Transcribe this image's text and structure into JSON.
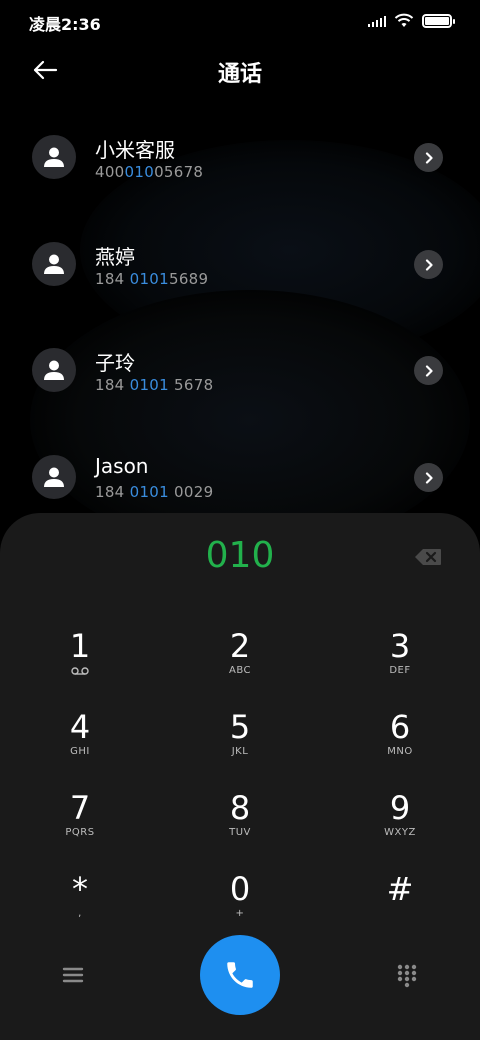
{
  "status": {
    "time": "凌晨2:36"
  },
  "header": {
    "title": "通话"
  },
  "contacts": [
    {
      "name": "小米客服",
      "num_pre": "400",
      "num_hl": "010",
      "num_post": "05678"
    },
    {
      "name": "燕婷",
      "num_pre": "184 ",
      "num_hl": "0101",
      "num_post": "5689"
    },
    {
      "name": "子玲",
      "num_pre": "184 ",
      "num_hl": "0101",
      "num_post": " 5678"
    },
    {
      "name": "Jason",
      "num_pre": "184 ",
      "num_hl": "0101",
      "num_post": " 0029"
    }
  ],
  "dialpad": {
    "entered": "010",
    "keys": [
      {
        "num": "1",
        "sub": ""
      },
      {
        "num": "2",
        "sub": "ABC"
      },
      {
        "num": "3",
        "sub": "DEF"
      },
      {
        "num": "4",
        "sub": "GHI"
      },
      {
        "num": "5",
        "sub": "JKL"
      },
      {
        "num": "6",
        "sub": "MNO"
      },
      {
        "num": "7",
        "sub": "PQRS"
      },
      {
        "num": "8",
        "sub": "TUV"
      },
      {
        "num": "9",
        "sub": "WXYZ"
      },
      {
        "num": "*",
        "sub": ","
      },
      {
        "num": "0",
        "sub": "+"
      },
      {
        "num": "#",
        "sub": ""
      }
    ]
  },
  "colors": {
    "accent_blue": "#1e8ff0",
    "digits_green": "#22b14c",
    "highlight": "#3a8dde"
  }
}
